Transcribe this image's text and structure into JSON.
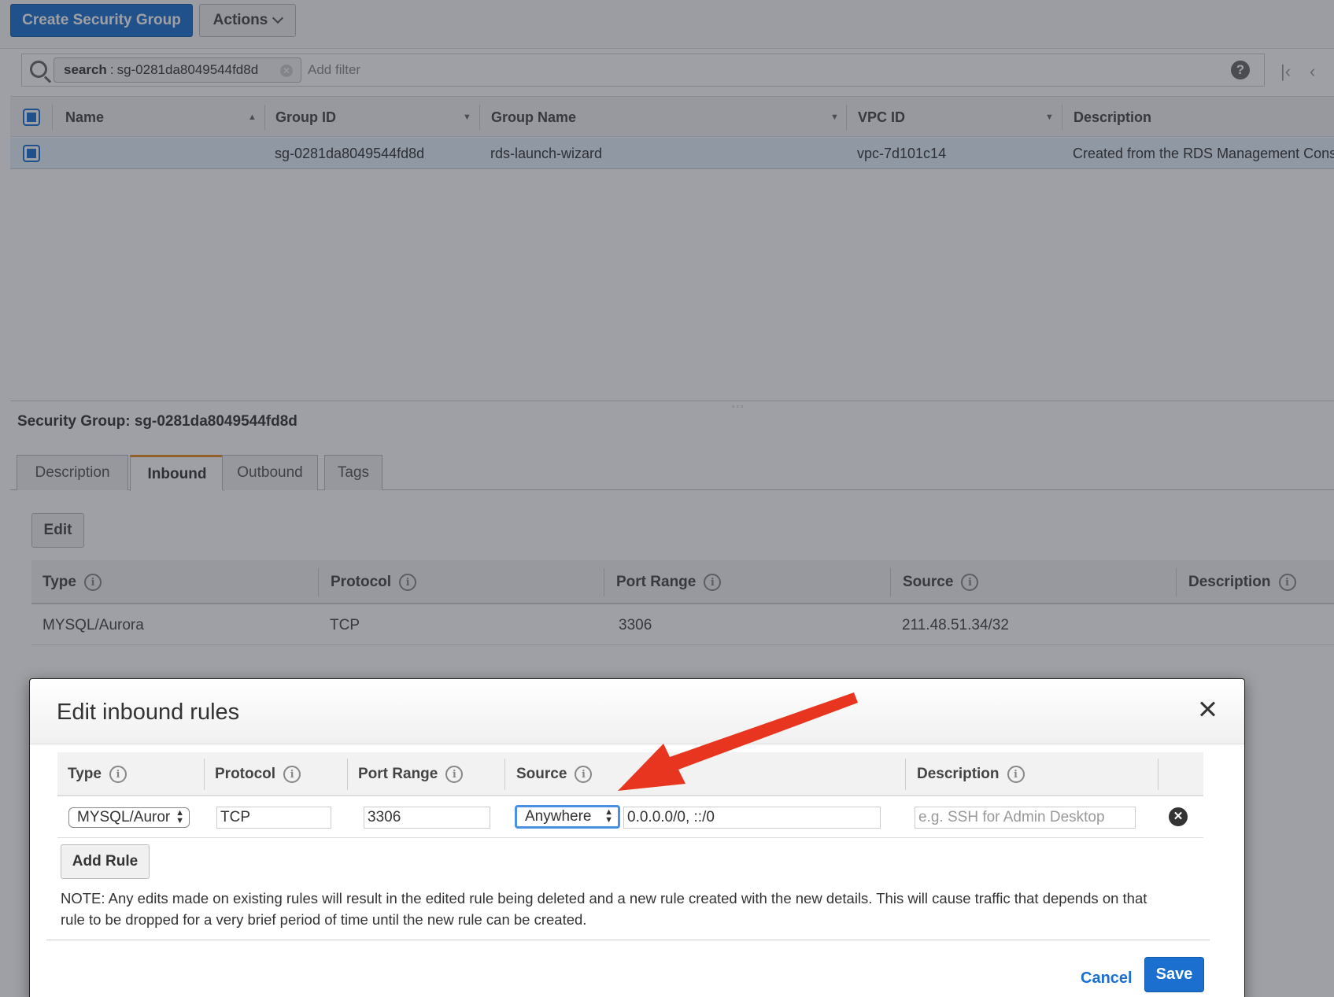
{
  "toolbar": {
    "create_label": "Create Security Group",
    "actions_label": "Actions"
  },
  "filter": {
    "chip_key": "search",
    "chip_sep": ":",
    "chip_value": "sg-0281da8049544fd8d",
    "add_filter_placeholder": "Add filter",
    "help_glyph": "?"
  },
  "grid": {
    "columns": [
      "Name",
      "Group ID",
      "Group Name",
      "VPC ID",
      "Description"
    ],
    "rows": [
      {
        "name": "",
        "group_id": "sg-0281da8049544fd8d",
        "group_name": "rds-launch-wizard",
        "vpc_id": "vpc-7d101c14",
        "description": "Created from the RDS Management Cons"
      }
    ]
  },
  "detail": {
    "title": "Security Group: sg-0281da8049544fd8d",
    "tabs": [
      "Description",
      "Inbound",
      "Outbound",
      "Tags"
    ],
    "active_tab": "Inbound",
    "edit_label": "Edit",
    "columns": [
      "Type",
      "Protocol",
      "Port Range",
      "Source",
      "Description"
    ],
    "rules": [
      {
        "type": "MYSQL/Aurora",
        "protocol": "TCP",
        "port_range": "3306",
        "source": "211.48.51.34/32",
        "description": ""
      }
    ]
  },
  "modal": {
    "title": "Edit inbound rules",
    "columns": [
      "Type",
      "Protocol",
      "Port Range",
      "Source",
      "Description"
    ],
    "rule": {
      "type": "MYSQL/Auror",
      "protocol": "TCP",
      "port_range": "3306",
      "source_select": "Anywhere",
      "source_value": "0.0.0.0/0, ::/0",
      "description_placeholder": "e.g. SSH for Admin Desktop"
    },
    "add_rule_label": "Add Rule",
    "note": "NOTE: Any edits made on existing rules will result in the edited rule being deleted and a new rule created with the new details. This will cause traffic that depends on that rule to be dropped for a very brief period of time until the new rule can be created.",
    "cancel_label": "Cancel",
    "save_label": "Save"
  },
  "colors": {
    "primary": "#1b70cf",
    "active_tab_accent": "#e88b1a",
    "annotation_arrow": "#e8351f",
    "focus_ring": "#4a90e2"
  }
}
